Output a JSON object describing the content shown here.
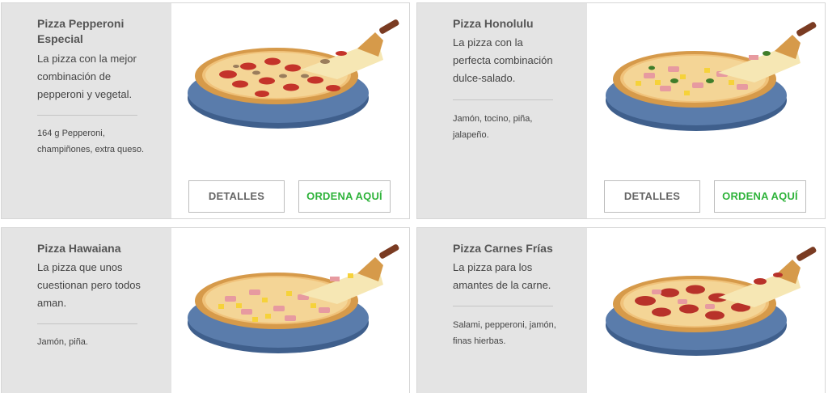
{
  "accent_green": "#2fb33b",
  "cards": [
    {
      "title": "Pizza Pepperoni Especial",
      "description": "La pizza con la mejor combinación de pepperoni y vegetal.",
      "ingredients": "164 g Pepperoni, champiñones, extra queso.",
      "details_label": "DETALLES",
      "order_label": "ORDENA AQUÍ",
      "toppings": "pepperoni-mushroom"
    },
    {
      "title": "Pizza Honolulu",
      "description": "La pizza con la perfecta combinación dulce-salado.",
      "ingredients": "Jamón, tocino, piña, jalapeño.",
      "details_label": "DETALLES",
      "order_label": "ORDENA AQUÍ",
      "toppings": "ham-pineapple-jalapeno"
    },
    {
      "title": "Pizza Hawaiana",
      "description": "La pizza que unos cuestionan pero todos aman.",
      "ingredients": "Jamón, piña.",
      "toppings": "ham-pineapple"
    },
    {
      "title": "Pizza Carnes Frías",
      "description": "La pizza para los amantes de la carne.",
      "ingredients": "Salami, pepperoni, jamón, finas hierbas.",
      "toppings": "salami-pepperoni-ham"
    }
  ]
}
